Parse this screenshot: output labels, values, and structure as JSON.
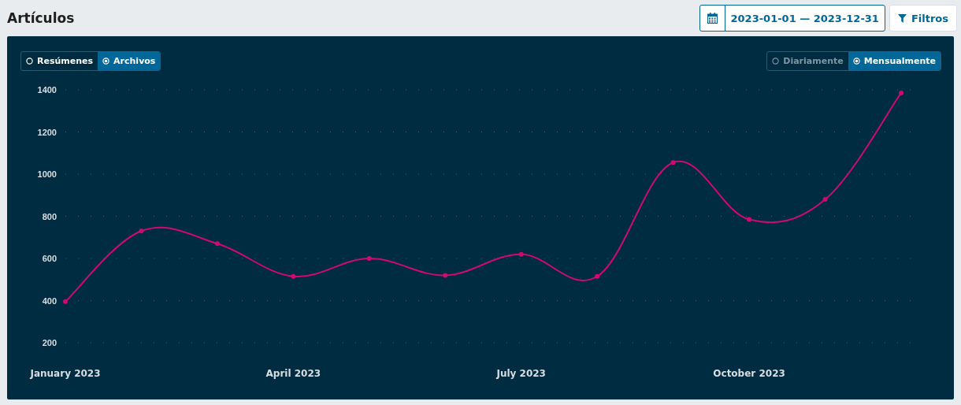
{
  "header": {
    "title": "Artículos",
    "date_range": "2023-01-01 — 2023-12-31",
    "filter_button": "Filtros"
  },
  "type_toggle": [
    {
      "label": "Resúmenes",
      "selected": false
    },
    {
      "label": "Archivos",
      "selected": true
    }
  ],
  "interval_toggle": [
    {
      "label": "Diariamente",
      "selected": false
    },
    {
      "label": "Mensualmente",
      "selected": true
    }
  ],
  "chart_data": {
    "type": "line",
    "categories": [
      "January 2023",
      null,
      null,
      "April 2023",
      null,
      null,
      "July 2023",
      null,
      null,
      "October 2023",
      null,
      null
    ],
    "grid": true,
    "series": [
      {
        "color": "#d00a6c",
        "marker": true,
        "values": [
          395,
          730,
          670,
          515,
          600,
          520,
          620,
          515,
          1055,
          785,
          880,
          1385
        ]
      }
    ],
    "ylim": [
      200,
      1400
    ],
    "yticks": [
      200,
      400,
      600,
      800,
      1000,
      1200,
      1400
    ]
  }
}
